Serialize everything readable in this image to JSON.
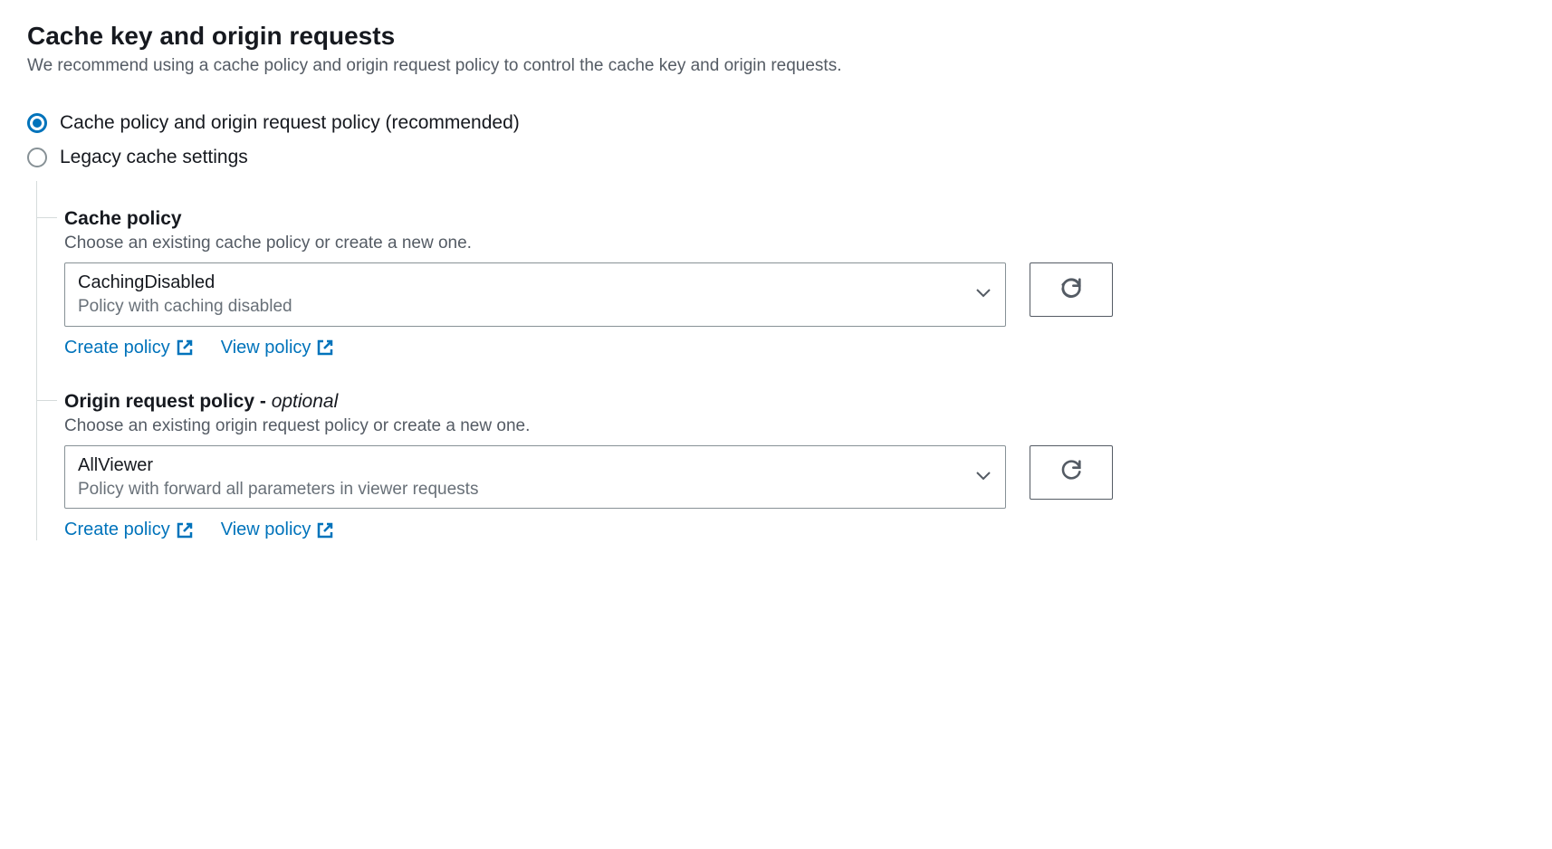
{
  "header": {
    "title": "Cache key and origin requests",
    "description": "We recommend using a cache policy and origin request policy to control the cache key and origin requests."
  },
  "radios": {
    "option1": "Cache policy and origin request policy (recommended)",
    "option2": "Legacy cache settings"
  },
  "cachePolicy": {
    "title": "Cache policy",
    "description": "Choose an existing cache policy or create a new one.",
    "selectedValue": "CachingDisabled",
    "selectedSub": "Policy with caching disabled",
    "createLink": "Create policy",
    "viewLink": "View policy"
  },
  "originPolicy": {
    "titlePrefix": "Origin request policy - ",
    "titleOptional": "optional",
    "description": "Choose an existing origin request policy or create a new one.",
    "selectedValue": "AllViewer",
    "selectedSub": "Policy with forward all parameters in viewer requests",
    "createLink": "Create policy",
    "viewLink": "View policy"
  }
}
